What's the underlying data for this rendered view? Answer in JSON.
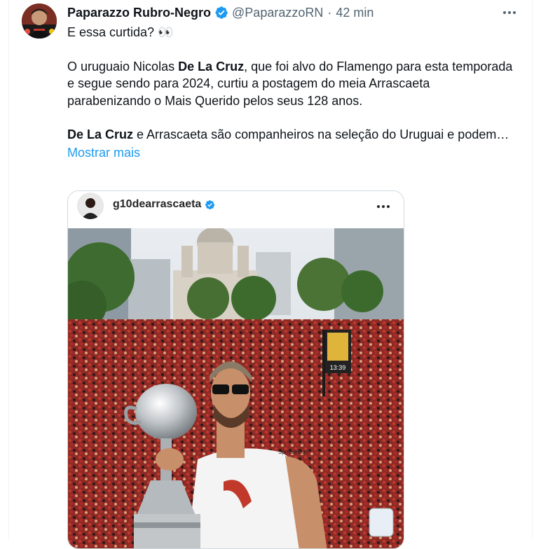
{
  "tweet": {
    "author_name": "Paparazzo Rubro-Negro",
    "handle": "@PaparazzoRN",
    "separator": "·",
    "time": "42 min",
    "more_label": "•••",
    "line1": "E essa curtida? 👀",
    "p2_a": "O uruguaio Nicolas ",
    "p2_b": "De La Cruz",
    "p2_c": ", que foi alvo do Flamengo para esta temporada e segue sendo para 2024, curtiu a postagem do meia Arrascaeta parabenizando o Mais Querido pelos seus 128 anos.",
    "p3_a": "De La Cruz",
    "p3_b": " e Arrascaeta são companheiros na seleção do Uruguai e podem…",
    "show_more": "Mostrar mais"
  },
  "embed": {
    "username": "g10dearrascaeta",
    "more_label": "•••",
    "clock_sign": "13:39",
    "shirt_sponsor": "Sportsbet.io"
  },
  "colors": {
    "link": "#1d9bf0",
    "verified": "#1d9bf0",
    "secondary_text": "#536471"
  }
}
